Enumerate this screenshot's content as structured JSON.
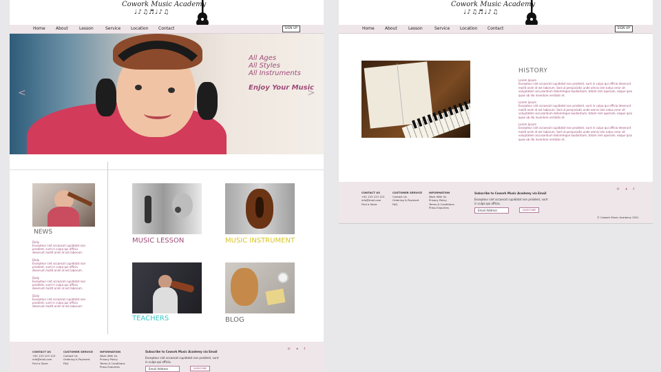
{
  "site": {
    "logo_text": "Cowork Music Academy",
    "logo_notes": "♩♪♫♬♩♪♫"
  },
  "nav": {
    "items": [
      "Home",
      "About",
      "Lesson",
      "Service",
      "Location",
      "Contact"
    ],
    "signup": "SIGN UP"
  },
  "hero": {
    "lines": [
      "All Ages",
      "All Styles",
      "All Instruments"
    ],
    "tagline": "Enjoy Your Music",
    "prev": "<",
    "next": ">"
  },
  "news": {
    "title": "NEWS",
    "items": [
      {
        "date": "Daily",
        "body": "Excepteur sint occaecat cupidatat non proident, sunt in culpa qui officia deserunt mollit anim id est laborum."
      },
      {
        "date": "Daily",
        "body": "Excepteur sint occaecat cupidatat non proident, sunt in culpa qui officia deserunt mollit anim id est laborum."
      },
      {
        "date": "Daily",
        "body": "Excepteur sint occaecat cupidatat non proident, sunt in culpa qui officia deserunt mollit anim id est laborum."
      },
      {
        "date": "Daily",
        "body": "Excepteur sint occaecat cupidatat non proident, sunt in culpa qui officia deserunt mollit anim id est laborum."
      }
    ]
  },
  "cards": [
    {
      "label": "MUSIC LESSON",
      "color": "#9d4b77"
    },
    {
      "label": "MUSIC INSTRUMENT",
      "color": "#d8c423"
    },
    {
      "label": "TEACHERS",
      "color": "#3cc6c6"
    },
    {
      "label": "BLOG",
      "color": "#666666"
    }
  ],
  "footer": {
    "contact": {
      "heading": "CONTACT US",
      "lines": [
        "+61 123 123 123",
        "info@mail.com",
        "Find a Store"
      ]
    },
    "service": {
      "heading": "CUSTOMER SERVICE",
      "lines": [
        "Contact Us",
        "Ordering & Payment",
        "FAQ"
      ]
    },
    "info": {
      "heading": "INFORMATION",
      "lines": [
        "Work With Us",
        "Privacy Policy",
        "Terms & Conditions",
        "Press Enquiries"
      ]
    },
    "subscribe": {
      "title": "Subscribe to Cowork Music Academy via Email",
      "text": "Excepteur sint occaecat cupidatat non proident, sunt in culpa qui officia.",
      "placeholder": "Email Address",
      "button": "SUBSCRIBE"
    },
    "social": "℗ ✦ f",
    "copyright": "© Cowork Music Academy 2021"
  },
  "history": {
    "title": "HISTORY",
    "sections": [
      {
        "sub": "Lorem Ipsum",
        "text": "Excepteur sint occaecat cupidatat non proident, sunt in culpa qui officia deserunt mollit anim id est laborum. Sed ut perspiciatis unde omnis iste natus error sit voluptatem accusantium doloremque laudantium, totam rem aperiam, eaque ipsa quae ab illo inventore veritatis et."
      },
      {
        "sub": "Lorem Ipsum",
        "text": "Excepteur sint occaecat cupidatat non proident, sunt in culpa qui officia deserunt mollit anim id est laborum. Sed ut perspiciatis unde omnis iste natus error sit voluptatem accusantium doloremque laudantium, totam rem aperiam, eaque ipsa quae ab illo inventore veritatis et."
      },
      {
        "sub": "Lorem Ipsum",
        "text": "Excepteur sint occaecat cupidatat non proident, sunt in culpa qui officia deserunt mollit anim id est laborum. Sed ut perspiciatis unde omnis iste natus error sit voluptatem accusantium doloremque laudantium, totam rem aperiam, eaque ipsa quae ab illo inventore veritatis et."
      }
    ]
  },
  "colors": {
    "accent": "#9d4b77",
    "nav_bg": "#efe6ea",
    "footer_bg": "#efe6ea"
  }
}
